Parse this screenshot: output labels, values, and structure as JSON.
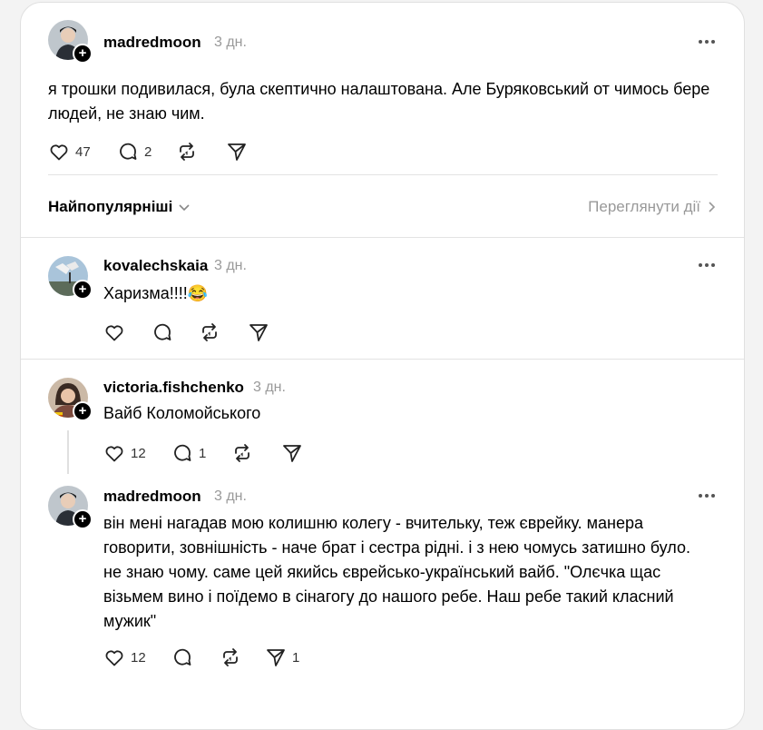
{
  "main_post": {
    "username": "madredmoon",
    "time": "3 дн.",
    "text": "я трошки подивилася, була скептично налаштована. Але Буряковський от чимось бере людей, не знаю чим.",
    "likes": "47",
    "replies": "2"
  },
  "sort": {
    "label": "Найпопулярніші",
    "activity_link": "Переглянути дії"
  },
  "replies": [
    {
      "username": "kovalechskaia",
      "time": "3 дн.",
      "text": "Харизма!!!!😂",
      "likes": "",
      "replies": ""
    },
    {
      "username": "victoria.fishchenko",
      "time": "3 дн.",
      "text": "Вайб Коломойського",
      "likes": "12",
      "replies": "1"
    },
    {
      "username": "madredmoon",
      "time": "3 дн.",
      "text": "він мені нагадав мою колишню колегу - вчительку, теж єврейку. манера говорити, зовнішність - наче брат і сестра рідні. і з нею чомусь затишно було. не знаю чому. саме цей якийсь єврейсько-український вайб. \"Олєчка щас візьмем вино і поїдемо в сінагогу до нашого ребе. Наш ребе такий класний мужик\"",
      "likes": "12",
      "replies": "",
      "shares": "1"
    }
  ],
  "icons": {
    "like": "heart-icon",
    "reply": "comment-icon",
    "repost": "repost-icon",
    "share": "send-icon",
    "more": "more-dots-icon",
    "follow": "plus-icon",
    "chevron": "chevron-down-icon"
  }
}
